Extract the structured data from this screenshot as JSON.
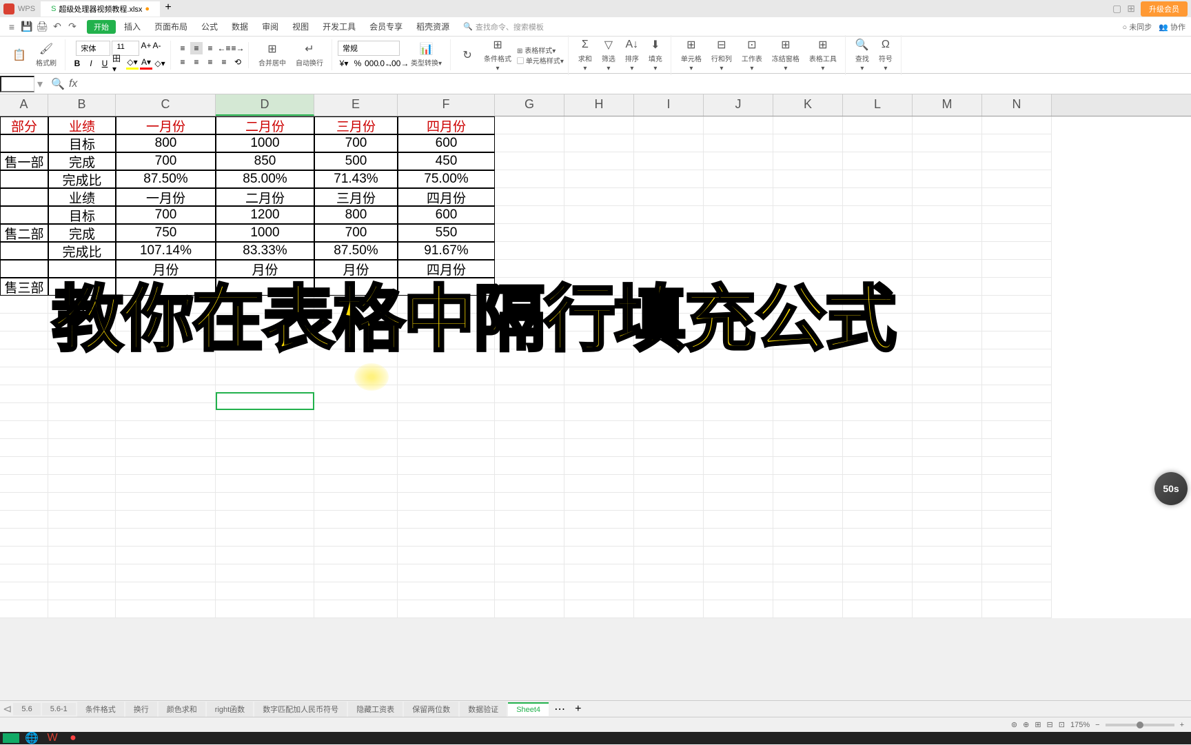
{
  "titlebar": {
    "filename": "超级处理器视频教程.xlsx",
    "upgrade_btn": "升级会员"
  },
  "menubar": {
    "file_pill": "开始",
    "items": [
      "插入",
      "页面布局",
      "公式",
      "数据",
      "审阅",
      "视图",
      "开发工具",
      "会员专享",
      "稻壳资源"
    ],
    "search_placeholder": "查找命令、搜索模板",
    "sync": "未同步",
    "cloud": "协作"
  },
  "toolbar": {
    "paste": "格式刷",
    "font_name": "宋体",
    "font_size": "11",
    "merge": "合并居中",
    "wrap": "自动换行",
    "number_format": "常规",
    "format": "表格样式",
    "cell_format": "单元格样式",
    "cond": "条件格式",
    "sum": "求和",
    "filter": "筛选",
    "sort": "排序",
    "fill": "填充",
    "cell": "单元格",
    "row_col": "行和列",
    "sheet": "工作表",
    "freeze": "冻结窗格",
    "tools": "表格工具",
    "find": "查找",
    "symbol": "符号"
  },
  "namebox": {
    "cell_ref": "",
    "fx": "fx"
  },
  "columns": [
    "A",
    "B",
    "C",
    "D",
    "E",
    "F",
    "G",
    "H",
    "I",
    "J",
    "K",
    "L",
    "M",
    "N"
  ],
  "active_col": "D",
  "table": {
    "rows": [
      {
        "A": "部分",
        "B": "业绩",
        "C": "一月份",
        "D": "二月份",
        "E": "三月份",
        "F": "四月份",
        "cls": "txt-red"
      },
      {
        "A": "",
        "B": "目标",
        "C": "800",
        "D": "1000",
        "E": "700",
        "F": "600"
      },
      {
        "A": "售一部",
        "B": "完成",
        "C": "700",
        "D": "850",
        "E": "500",
        "F": "450"
      },
      {
        "A": "",
        "B": "完成比",
        "C": "87.50%",
        "D": "85.00%",
        "E": "71.43%",
        "F": "75.00%"
      },
      {
        "A": "",
        "B": "业绩",
        "C": "一月份",
        "D": "二月份",
        "E": "三月份",
        "F": "四月份"
      },
      {
        "A": "",
        "B": "目标",
        "C": "700",
        "D": "1200",
        "E": "800",
        "F": "600"
      },
      {
        "A": "售二部",
        "B": "完成",
        "C": "750",
        "D": "1000",
        "E": "700",
        "F": "550"
      },
      {
        "A": "",
        "B": "完成比",
        "C": "107.14%",
        "D": "83.33%",
        "E": "87.50%",
        "F": "91.67%"
      },
      {
        "A": "",
        "B": "",
        "C": "月份",
        "D": "月份",
        "E": "月份",
        "F": "四月份"
      },
      {
        "A": "售三部",
        "B": "",
        "C": "",
        "D": "",
        "E": "",
        "F": ""
      }
    ]
  },
  "overlay": "教你在表格中隔行填充公式",
  "sheets": [
    "5.6",
    "5.6-1",
    "条件格式",
    "换行",
    "颜色求和",
    "right函数",
    "数字匹配加人民币符号",
    "隐藏工资表",
    "保留两位数",
    "数据验证",
    "Sheet4"
  ],
  "active_sheet": "Sheet4",
  "statusbar": {
    "zoom": "175%"
  },
  "recorder": "50s"
}
